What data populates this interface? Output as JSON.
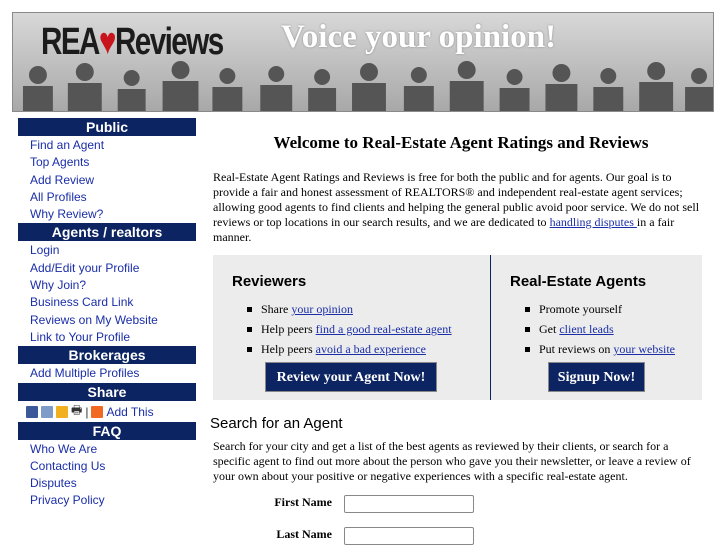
{
  "header": {
    "logo": {
      "part1": "REA",
      "mark": "♥",
      "part2": "Reviews"
    },
    "slogan": "Voice your opinion!"
  },
  "sidebar": {
    "public": {
      "heading": "Public",
      "items": [
        "Find an Agent",
        "Top Agents",
        "Add Review",
        "All Profiles",
        "Why Review?"
      ]
    },
    "agents": {
      "heading": "Agents / realtors",
      "items": [
        "Login",
        "Add/Edit your Profile",
        "Why Join?",
        "Business Card Link",
        "Reviews on My Website",
        "Link to Your Profile"
      ]
    },
    "brokerages": {
      "heading": "Brokerages",
      "items": [
        "Add Multiple Profiles"
      ]
    },
    "share": {
      "heading": "Share",
      "separator": "|",
      "add_this": "Add This"
    },
    "faq": {
      "heading": "FAQ",
      "items": [
        "Who We Are",
        "Contacting Us",
        "Disputes",
        "Privacy Policy"
      ]
    }
  },
  "main": {
    "title": "Welcome to Real-Estate Agent Ratings and Reviews",
    "intro_text": "Real-Estate Agent Ratings and Reviews is free for both the public and for agents. Our goal is to provide a fair and honest assessment of REALTORS® and independent real-estate agent services; allowing good agents to find clients and helping the general public avoid poor service. We do not sell reviews or top locations in our search results, and we are dedicated to ",
    "intro_link": "handling disputes ",
    "intro_end": "in a fair manner.",
    "reviewers": {
      "heading": "Reviewers",
      "items": [
        {
          "text": "Share ",
          "link": "your opinion"
        },
        {
          "text": "Help peers ",
          "link": "find a good real-estate agent"
        },
        {
          "text": "Help peers ",
          "link": "avoid a bad experience"
        }
      ],
      "button": "Review your Agent Now!"
    },
    "agents_panel": {
      "heading": "Real-Estate Agents",
      "items": [
        {
          "text": "Promote yourself",
          "link": ""
        },
        {
          "text": "Get ",
          "link": "client leads"
        },
        {
          "text": "Put reviews on ",
          "link": "your website"
        }
      ],
      "button": "Signup Now!"
    },
    "search": {
      "title": "Search for an Agent",
      "description": "Search for your city and get a list of the best agents as reviewed by their clients, or search for a specific agent to find out more about the person who gave you their newsletter, or leave a review of your own about your positive or negative experiences with a specific real-estate agent.",
      "first_name_label": "First Name",
      "first_name_value": "",
      "last_name_label": "Last Name",
      "last_name_value": ""
    }
  },
  "colors": {
    "nav_bar": "#0c2461",
    "link": "#1a2ea8",
    "logo_mark": "#c8141c",
    "panel_bg": "#ececec"
  }
}
